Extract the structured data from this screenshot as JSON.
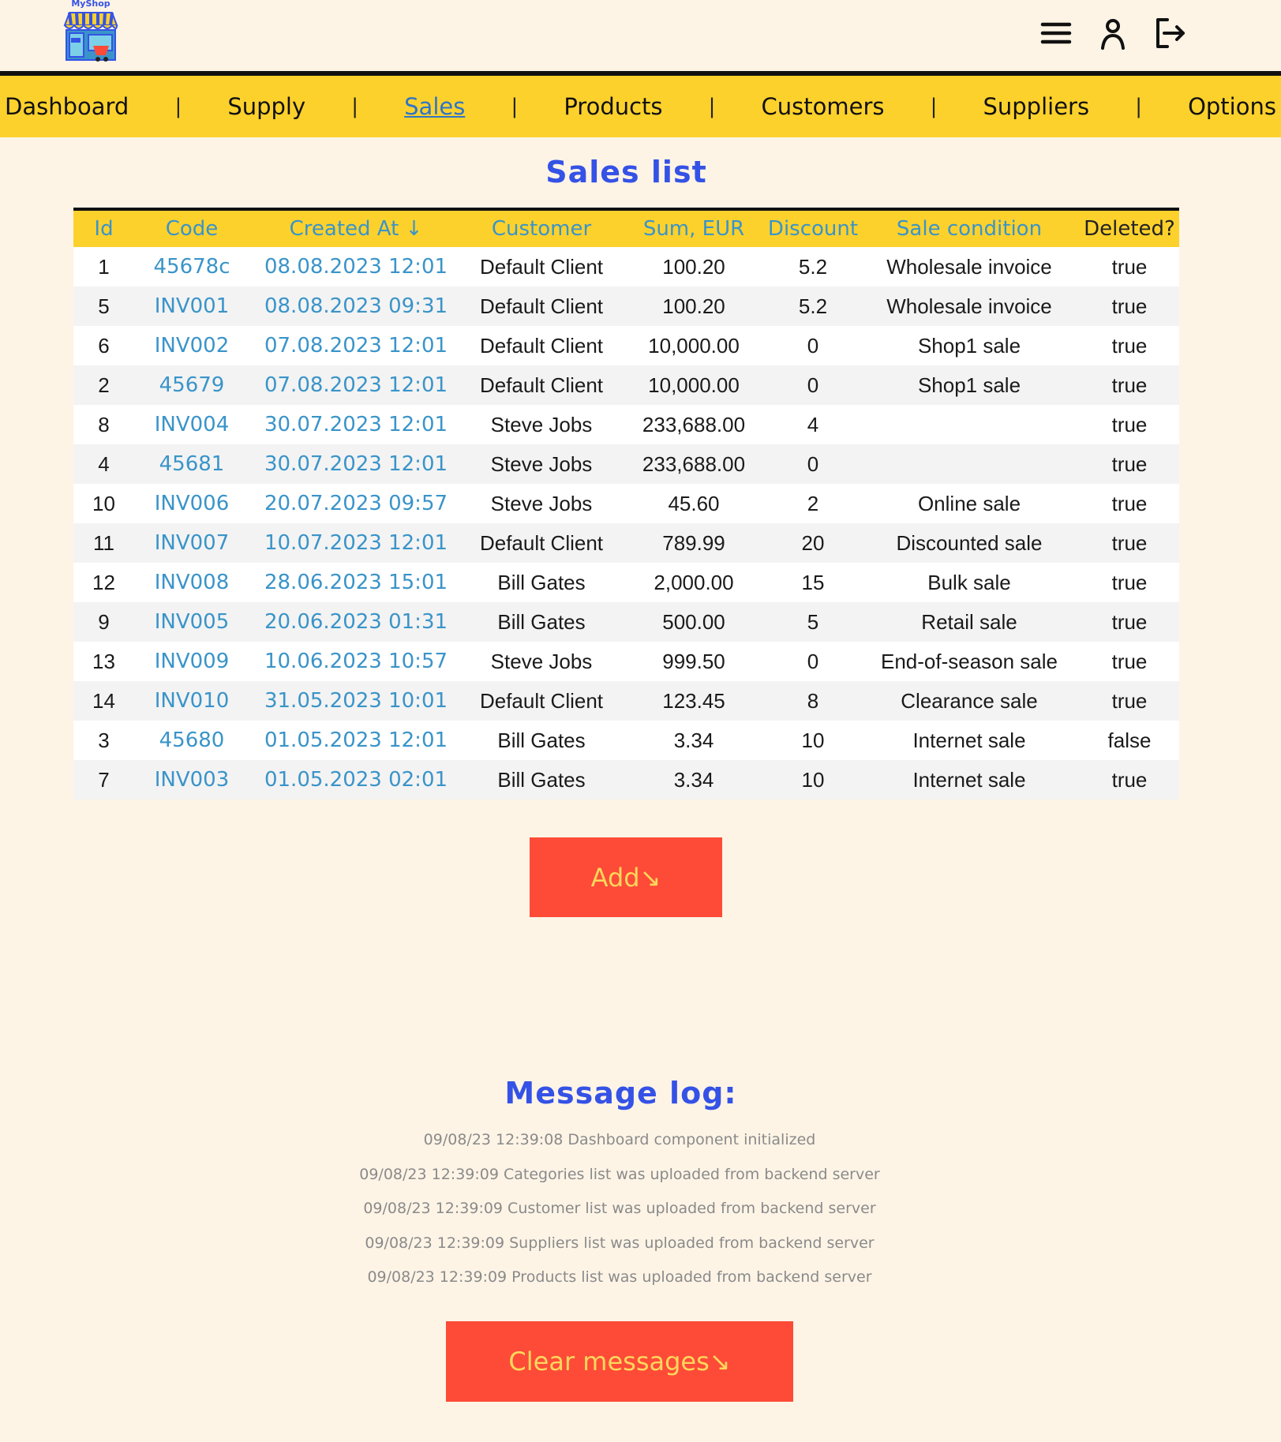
{
  "header": {
    "logo_text": "MyShop",
    "icons": [
      "menu-icon",
      "user-icon",
      "logout-icon"
    ]
  },
  "nav": {
    "items": [
      "Dashboard",
      "Supply",
      "Sales",
      "Products",
      "Customers",
      "Suppliers",
      "Options"
    ],
    "active": "Sales",
    "separator": "|"
  },
  "page_title": "Sales list",
  "table": {
    "columns": [
      "Id",
      "Code",
      "Created At ↓",
      "Customer",
      "Sum, EUR",
      "Discount",
      "Sale condition",
      "Deleted?"
    ],
    "rows": [
      [
        "1",
        "45678c",
        "08.08.2023 12:01",
        "Default Client",
        "100.20",
        "5.2",
        "Wholesale invoice",
        "true"
      ],
      [
        "5",
        "INV001",
        "08.08.2023 09:31",
        "Default Client",
        "100.20",
        "5.2",
        "Wholesale invoice",
        "true"
      ],
      [
        "6",
        "INV002",
        "07.08.2023 12:01",
        "Default Client",
        "10,000.00",
        "0",
        "Shop1 sale",
        "true"
      ],
      [
        "2",
        "45679",
        "07.08.2023 12:01",
        "Default Client",
        "10,000.00",
        "0",
        "Shop1 sale",
        "true"
      ],
      [
        "8",
        "INV004",
        "30.07.2023 12:01",
        "Steve Jobs",
        "233,688.00",
        "4",
        "",
        "true"
      ],
      [
        "4",
        "45681",
        "30.07.2023 12:01",
        "Steve Jobs",
        "233,688.00",
        "0",
        "",
        "true"
      ],
      [
        "10",
        "INV006",
        "20.07.2023 09:57",
        "Steve Jobs",
        "45.60",
        "2",
        "Online sale",
        "true"
      ],
      [
        "11",
        "INV007",
        "10.07.2023 12:01",
        "Default Client",
        "789.99",
        "20",
        "Discounted sale",
        "true"
      ],
      [
        "12",
        "INV008",
        "28.06.2023 15:01",
        "Bill Gates",
        "2,000.00",
        "15",
        "Bulk sale",
        "true"
      ],
      [
        "9",
        "INV005",
        "20.06.2023 01:31",
        "Bill Gates",
        "500.00",
        "5",
        "Retail sale",
        "true"
      ],
      [
        "13",
        "INV009",
        "10.06.2023 10:57",
        "Steve Jobs",
        "999.50",
        "0",
        "End-of-season sale",
        "true"
      ],
      [
        "14",
        "INV010",
        "31.05.2023 10:01",
        "Default Client",
        "123.45",
        "8",
        "Clearance sale",
        "true"
      ],
      [
        "3",
        "45680",
        "01.05.2023 12:01",
        "Bill Gates",
        "3.34",
        "10",
        "Internet sale",
        "false"
      ],
      [
        "7",
        "INV003",
        "01.05.2023 02:01",
        "Bill Gates",
        "3.34",
        "10",
        "Internet sale",
        "true"
      ]
    ]
  },
  "add_button": "Add↘",
  "message_log": {
    "title": "Message log:",
    "messages": [
      "09/08/23 12:39:08 Dashboard component initialized",
      "09/08/23 12:39:09 Categories list was uploaded from backend server",
      "09/08/23 12:39:09 Customer list was uploaded from backend server",
      "09/08/23 12:39:09 Suppliers list was uploaded from backend server",
      "09/08/23 12:39:09 Products list was uploaded from backend server"
    ],
    "clear_button": "Clear messages↘"
  },
  "colors": {
    "background": "#fdf4e6",
    "accent_yellow": "#fdd12c",
    "title_blue": "#3552e6",
    "link_blue": "#3a94c9",
    "button_red": "#fd4b38",
    "button_text": "#fdd75c"
  }
}
